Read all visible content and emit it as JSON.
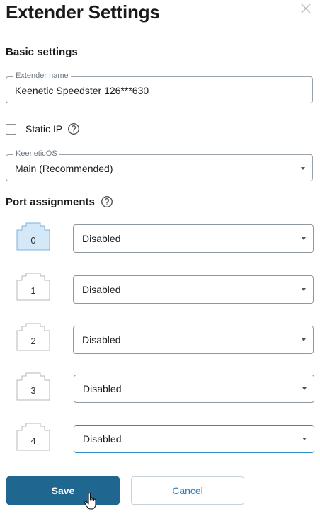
{
  "dialog": {
    "title": "Extender Settings",
    "close_icon": "close-icon"
  },
  "basic": {
    "section_title": "Basic settings",
    "extender_name_label": "Extender name",
    "extender_name_value": "Keenetic Speedster 126***630",
    "static_ip_label": "Static IP",
    "static_ip_checked": false,
    "keeneticos_label": "KeeneticOS",
    "keeneticos_value": "Main (Recommended)"
  },
  "ports": {
    "section_title": "Port assignments",
    "items": [
      {
        "number": "0",
        "assignment": "Disabled",
        "active": true
      },
      {
        "number": "1",
        "assignment": "Disabled",
        "active": false
      },
      {
        "number": "2",
        "assignment": "Disabled",
        "active": false
      },
      {
        "number": "3",
        "assignment": "Disabled",
        "active": false
      },
      {
        "number": "4",
        "assignment": "Disabled",
        "active": false
      }
    ]
  },
  "actions": {
    "save_label": "Save",
    "cancel_label": "Cancel"
  },
  "colors": {
    "primary": "#1f6791",
    "link": "#2f7ab5",
    "port_active_fill": "#d4e8f7",
    "port_active_stroke": "#7fb3d9",
    "focus_border": "#2f8bc4"
  }
}
